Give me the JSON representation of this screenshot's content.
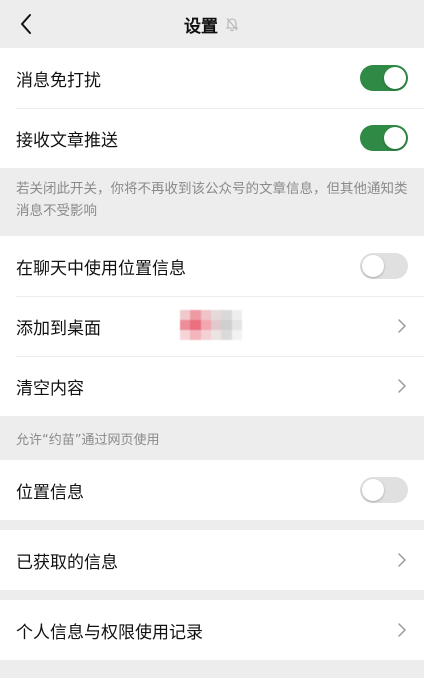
{
  "header": {
    "title": "设置"
  },
  "group1": {
    "items": [
      {
        "label": "消息免打扰",
        "toggle": "on"
      },
      {
        "label": "接收文章推送",
        "toggle": "on"
      }
    ]
  },
  "hint": "若关闭此开关，你将不再收到该公众号的文章信息，但其他通知类消息不受影响",
  "group2": {
    "items": [
      {
        "label": "在聊天中使用位置信息",
        "toggle": "off"
      },
      {
        "label": "添加到桌面"
      },
      {
        "label": "清空内容"
      }
    ]
  },
  "caption": "允许“约苗”通过网页使用",
  "group3": {
    "items": [
      {
        "label": "位置信息",
        "toggle": "off"
      }
    ]
  },
  "group4": {
    "items": [
      {
        "label": "已获取的信息"
      }
    ]
  },
  "group5": {
    "items": [
      {
        "label": "个人信息与权限使用记录"
      }
    ]
  },
  "colors": {
    "accent": "#2f8a45",
    "background": "#ededed"
  }
}
